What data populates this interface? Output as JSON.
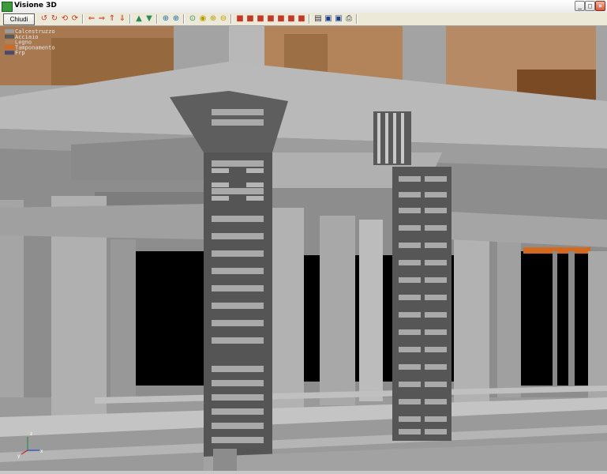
{
  "window": {
    "title": "Visione 3D",
    "controls": [
      "minimize",
      "maximize",
      "close"
    ]
  },
  "toolbar": {
    "close_label": "Chiudi",
    "tools": [
      {
        "icon": "rotate-left-icon",
        "glyph": "↺",
        "color": "#c0392b"
      },
      {
        "icon": "rotate-right-icon",
        "glyph": "↻",
        "color": "#c0392b"
      },
      {
        "icon": "rotate-up-icon",
        "glyph": "⟲",
        "color": "#c0392b"
      },
      {
        "icon": "rotate-down-icon",
        "glyph": "⟳",
        "color": "#c0392b"
      },
      {
        "icon": "pan-left-icon",
        "glyph": "⇐",
        "color": "#c0392b"
      },
      {
        "icon": "pan-right-icon",
        "glyph": "⇒",
        "color": "#c0392b"
      },
      {
        "icon": "pan-up-icon",
        "glyph": "⇑",
        "color": "#c0392b"
      },
      {
        "icon": "pan-down-icon",
        "glyph": "⇓",
        "color": "#c0392b"
      },
      {
        "icon": "move-forward-icon",
        "glyph": "▲",
        "color": "#2e8b57"
      },
      {
        "icon": "move-back-icon",
        "glyph": "▼",
        "color": "#2e8b57"
      },
      {
        "icon": "zoom-icon",
        "glyph": "⊕",
        "color": "#1f6fa8"
      },
      {
        "icon": "zoom-in-icon",
        "glyph": "⊕",
        "color": "#1f6fa8"
      },
      {
        "icon": "zoom-extent-icon",
        "glyph": "⊙",
        "color": "#2e8b57"
      },
      {
        "icon": "zoom-window-icon",
        "glyph": "◉",
        "color": "#b8a000"
      },
      {
        "icon": "zoom-in-alt-icon",
        "glyph": "⊕",
        "color": "#b8a000"
      },
      {
        "icon": "zoom-out-icon",
        "glyph": "⊖",
        "color": "#b8a000"
      },
      {
        "icon": "view-front-icon",
        "glyph": "■",
        "color": "#c0392b"
      },
      {
        "icon": "view-back-icon",
        "glyph": "■",
        "color": "#c0392b"
      },
      {
        "icon": "view-left-icon",
        "glyph": "■",
        "color": "#c0392b"
      },
      {
        "icon": "view-right-icon",
        "glyph": "■",
        "color": "#c0392b"
      },
      {
        "icon": "view-top-icon",
        "glyph": "■",
        "color": "#c0392b"
      },
      {
        "icon": "view-iso-icon",
        "glyph": "■",
        "color": "#c0392b"
      },
      {
        "icon": "view-iso-alt-icon",
        "glyph": "■",
        "color": "#c0392b"
      },
      {
        "icon": "notes-icon",
        "glyph": "▤",
        "color": "#333333"
      },
      {
        "icon": "save-icon",
        "glyph": "▣",
        "color": "#1f3f8a"
      },
      {
        "icon": "save-as-icon",
        "glyph": "▣",
        "color": "#1f3f8a"
      },
      {
        "icon": "print-icon",
        "glyph": "⎙",
        "color": "#333333"
      }
    ]
  },
  "legend": [
    {
      "label": "Calcestruzzo",
      "color": "#9a9a9a"
    },
    {
      "label": "Acciaio",
      "color": "#5a5a5a"
    },
    {
      "label": "Legno",
      "color": "#b08054"
    },
    {
      "label": "Tamponamento",
      "color": "#d2691e"
    },
    {
      "label": "Frp",
      "color": "#4a4a6a"
    }
  ],
  "axes": {
    "x_label": "x",
    "y_label": "y",
    "z_label": "z"
  },
  "colors": {
    "concrete": "#9e9e9e",
    "concrete_light": "#b4b4b4",
    "steel": "#555555",
    "wood": "#a87850",
    "wood_dark": "#7a4a24",
    "infill": "#d2691e",
    "void": "#000000"
  }
}
